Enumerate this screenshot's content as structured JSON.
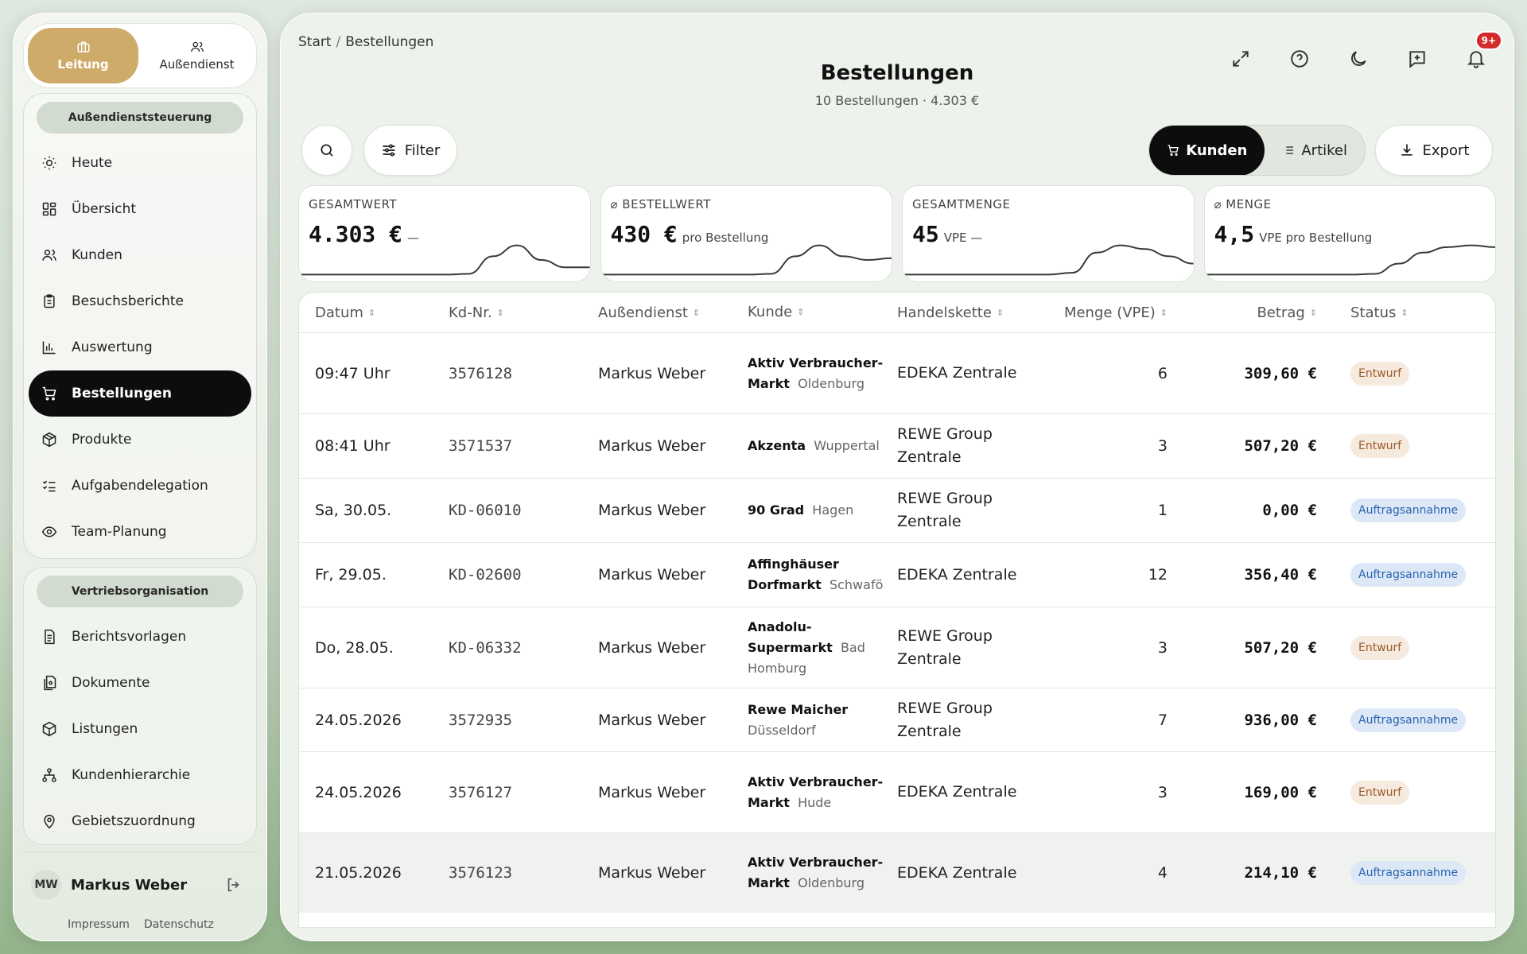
{
  "sidebar": {
    "roles": [
      {
        "label": "Leitung",
        "icon": "briefcase-icon",
        "active": true
      },
      {
        "label": "Außendienst",
        "icon": "users-icon",
        "active": false
      }
    ],
    "group1_title": "Außendienststeuerung",
    "group1_items": [
      {
        "label": "Heute",
        "icon": "sun-icon"
      },
      {
        "label": "Übersicht",
        "icon": "dashboard-icon"
      },
      {
        "label": "Kunden",
        "icon": "users-icon"
      },
      {
        "label": "Besuchsberichte",
        "icon": "clipboard-icon"
      },
      {
        "label": "Auswertung",
        "icon": "bar-chart-icon"
      },
      {
        "label": "Bestellungen",
        "icon": "cart-icon",
        "active": true
      },
      {
        "label": "Produkte",
        "icon": "package-icon"
      },
      {
        "label": "Aufgabendelegation",
        "icon": "checklist-icon"
      },
      {
        "label": "Team-Planung",
        "icon": "eye-icon"
      }
    ],
    "group2_title": "Vertriebsorganisation",
    "group2_items": [
      {
        "label": "Berichtsvorlagen",
        "icon": "document-icon"
      },
      {
        "label": "Dokumente",
        "icon": "documents-icon"
      },
      {
        "label": "Listungen",
        "icon": "package-icon"
      },
      {
        "label": "Kundenhierarchie",
        "icon": "hierarchy-icon"
      },
      {
        "label": "Gebietszuordnung",
        "icon": "map-pin-icon"
      }
    ],
    "user": {
      "initials": "MW",
      "name": "Markus Weber"
    },
    "footer": {
      "impressum": "Impressum",
      "datenschutz": "Datenschutz"
    }
  },
  "header": {
    "breadcrumb_start": "Start",
    "breadcrumb_sep": "/",
    "breadcrumb_current": "Bestellungen",
    "title": "Bestellungen",
    "subtitle": "10 Bestellungen · 4.303 €",
    "notification_badge": "9+"
  },
  "toolbar": {
    "filter_label": "Filter",
    "view_kunden": "Kunden",
    "view_artikel": "Artikel",
    "export_label": "Export"
  },
  "kpis": [
    {
      "label": "GESAMTWERT",
      "value": "4.303 €",
      "unit": "—",
      "trend": [
        0.1,
        0.1,
        0.1,
        0.1,
        0.1,
        0.1,
        0.1,
        0.12,
        0.6,
        0.9,
        0.5,
        0.3,
        0.3
      ]
    },
    {
      "label": "⌀ BESTELLWERT",
      "value": "430 €",
      "unit": "pro Bestellung",
      "trend": [
        0.1,
        0.1,
        0.1,
        0.1,
        0.1,
        0.1,
        0.1,
        0.12,
        0.6,
        0.9,
        0.6,
        0.5,
        0.55
      ]
    },
    {
      "label": "GESAMTMENGE",
      "value": "45",
      "unit": "VPE —",
      "trend": [
        0.1,
        0.1,
        0.1,
        0.1,
        0.1,
        0.1,
        0.1,
        0.15,
        0.7,
        0.9,
        0.8,
        0.6,
        0.4
      ]
    },
    {
      "label": "⌀ MENGE",
      "value": "4,5",
      "unit": "VPE  pro Bestellung",
      "trend": [
        0.1,
        0.1,
        0.1,
        0.1,
        0.1,
        0.1,
        0.1,
        0.12,
        0.4,
        0.7,
        0.85,
        0.9,
        0.85
      ]
    }
  ],
  "table": {
    "headers": [
      "Datum",
      "Kd-Nr.",
      "Außendienst",
      "Kunde",
      "Handelskette",
      "Menge (VPE)",
      "Betrag",
      "Status"
    ],
    "rows": [
      {
        "datum": "09:47 Uhr",
        "kdnr": "3576128",
        "ad": "Markus Weber",
        "kunde": "Aktiv Verbraucher-Markt",
        "ort": "Oldenburg",
        "kette": "EDEKA Zentrale",
        "menge": "6",
        "betrag": "309,60 €",
        "status": "Entwurf",
        "type": "entwurf",
        "h": 102
      },
      {
        "datum": "08:41 Uhr",
        "kdnr": "3571537",
        "ad": "Markus Weber",
        "kunde": "Akzenta",
        "ort": "Wuppertal",
        "kette": "REWE Group Zentrale",
        "menge": "3",
        "betrag": "507,20 €",
        "status": "Entwurf",
        "type": "entwurf",
        "h": 81
      },
      {
        "datum": "Sa, 30.05.",
        "kdnr": "KD-06010",
        "ad": "Markus Weber",
        "kunde": "90 Grad",
        "ort": "Hagen",
        "kette": "REWE Group Zentrale",
        "menge": "1",
        "betrag": "0,00 €",
        "status": "Auftragsannahme",
        "type": "auftrag",
        "h": 81
      },
      {
        "datum": "Fr, 29.05.",
        "kdnr": "KD-02600",
        "ad": "Markus Weber",
        "kunde": "Affinghäuser Dorfmarkt",
        "ort": "Schwafö",
        "kette": "EDEKA Zentrale",
        "menge": "12",
        "betrag": "356,40 €",
        "status": "Auftragsannahme",
        "type": "auftrag",
        "h": 81
      },
      {
        "datum": "Do, 28.05.",
        "kdnr": "KD-06332",
        "ad": "Markus Weber",
        "kunde": "Anadolu-Supermarkt",
        "ort": "Bad Homburg",
        "kette": "REWE Group Zentrale",
        "menge": "3",
        "betrag": "507,20 €",
        "status": "Entwurf",
        "type": "entwurf",
        "h": 102
      },
      {
        "datum": "24.05.2026",
        "kdnr": "3572935",
        "ad": "Markus Weber",
        "kunde": "Rewe Maicher",
        "ort": "Düsseldorf",
        "kette": "REWE Group Zentrale",
        "menge": "7",
        "betrag": "936,00 €",
        "status": "Auftragsannahme",
        "type": "auftrag",
        "h": 80
      },
      {
        "datum": "24.05.2026",
        "kdnr": "3576127",
        "ad": "Markus Weber",
        "kunde": "Aktiv Verbraucher-Markt",
        "ort": "Hude",
        "kette": "EDEKA Zentrale",
        "menge": "3",
        "betrag": "169,00 €",
        "status": "Entwurf",
        "type": "entwurf",
        "h": 102
      },
      {
        "datum": "21.05.2026",
        "kdnr": "3576123",
        "ad": "Markus Weber",
        "kunde": "Aktiv Verbraucher-Markt",
        "ort": "Oldenburg",
        "kette": "EDEKA Zentrale",
        "menge": "4",
        "betrag": "214,10 €",
        "status": "Auftragsannahme",
        "type": "auftrag",
        "h": 101,
        "highlight": true
      }
    ]
  },
  "colors": {
    "accent_gold": "#cfab6a",
    "active_dark": "#0d0d0d",
    "entwurf": "#9a5a28",
    "auftrag": "#2a63b0",
    "badge_red": "#d42a2a"
  }
}
